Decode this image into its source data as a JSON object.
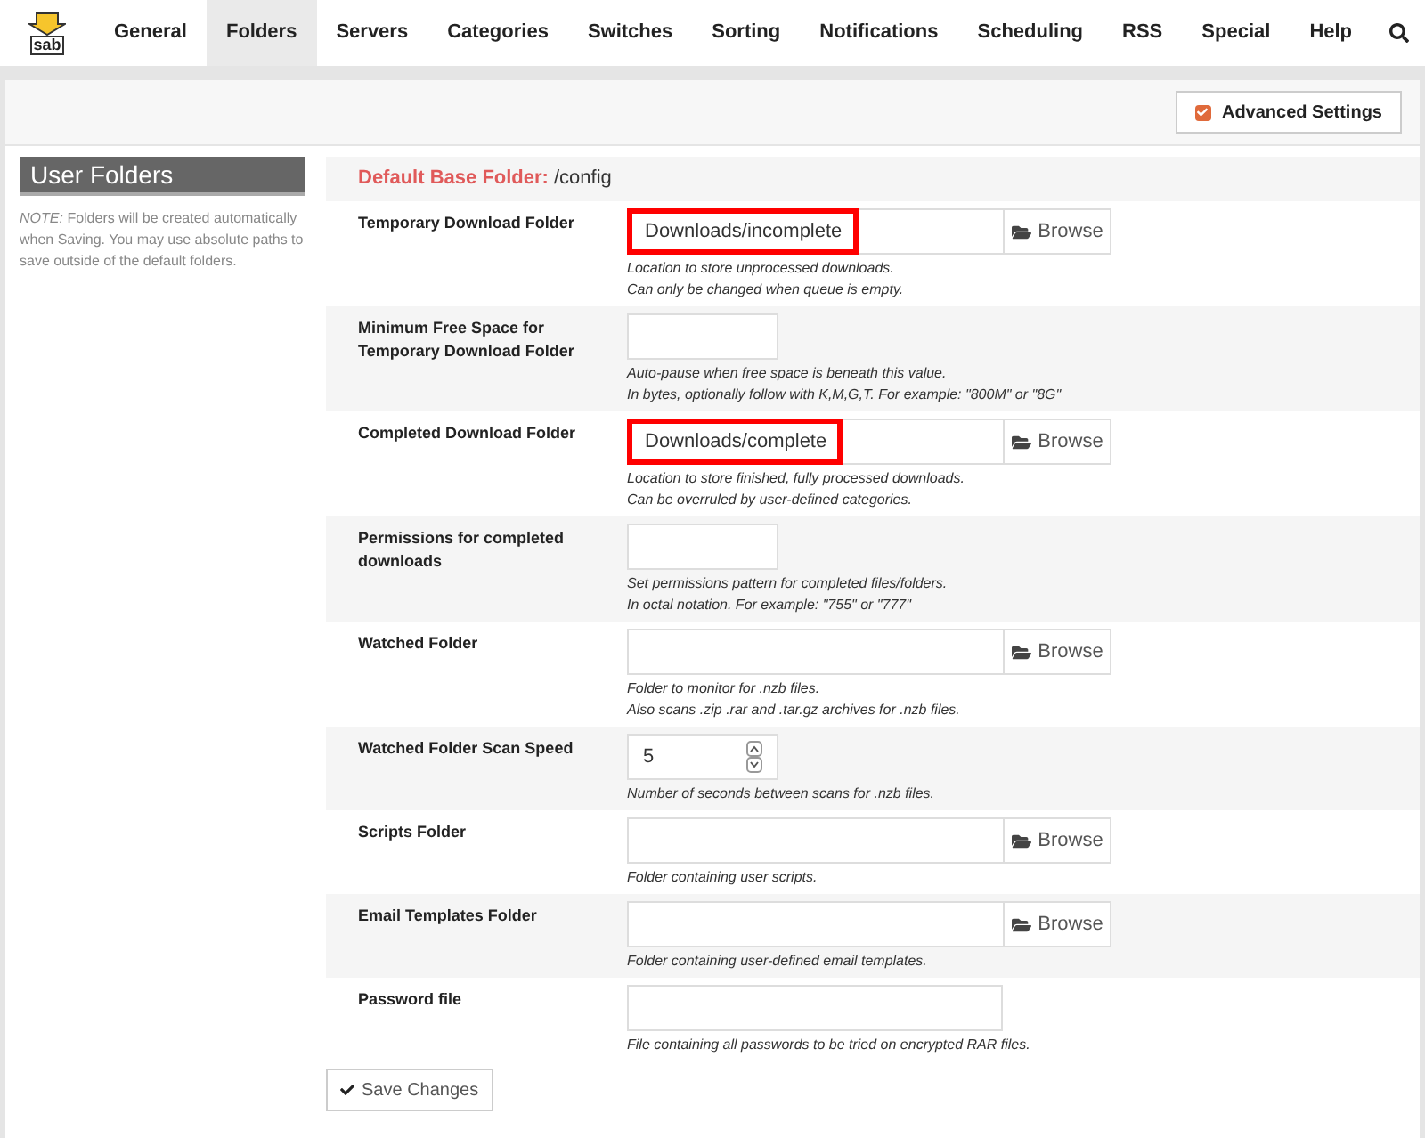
{
  "logo": {
    "text": "sab"
  },
  "nav": [
    {
      "label": "General",
      "selected": false
    },
    {
      "label": "Folders",
      "selected": true
    },
    {
      "label": "Servers",
      "selected": false
    },
    {
      "label": "Categories",
      "selected": false
    },
    {
      "label": "Switches",
      "selected": false
    },
    {
      "label": "Sorting",
      "selected": false
    },
    {
      "label": "Notifications",
      "selected": false
    },
    {
      "label": "Scheduling",
      "selected": false
    },
    {
      "label": "RSS",
      "selected": false
    },
    {
      "label": "Special",
      "selected": false
    },
    {
      "label": "Help",
      "selected": false
    }
  ],
  "advanced_settings": {
    "label": "Advanced Settings",
    "checked": true
  },
  "section": {
    "title": "User Folders",
    "note_label": "NOTE:",
    "note": "Folders will be created automatically when Saving. You may use absolute paths to save outside of the default folders."
  },
  "base_folder": {
    "label": "Default Base Folder:",
    "value": "/config"
  },
  "rows": [
    {
      "kind": "folder",
      "label": "Temporary Download Folder",
      "value": "Downloads/incomplete",
      "highlighted": true,
      "button": "Browse",
      "help": [
        "Location to store unprocessed downloads.",
        "Can only be changed when queue is empty."
      ]
    },
    {
      "kind": "text",
      "label": "Minimum Free Space for Temporary Download Folder",
      "value": "",
      "highlighted": false,
      "help": [
        "Auto-pause when free space is beneath this value.",
        "In bytes, optionally follow with K,M,G,T. For example: \"800M\" or \"8G\""
      ]
    },
    {
      "kind": "folder",
      "label": "Completed Download Folder",
      "value": "Downloads/complete",
      "highlighted": true,
      "button": "Browse",
      "help": [
        "Location to store finished, fully processed downloads.",
        "Can be overruled by user-defined categories."
      ]
    },
    {
      "kind": "text",
      "label": "Permissions for completed downloads",
      "value": "",
      "highlighted": false,
      "help": [
        "Set permissions pattern for completed files/folders.",
        "In octal notation. For example: \"755\" or \"777\""
      ]
    },
    {
      "kind": "folder",
      "label": "Watched Folder",
      "value": "",
      "highlighted": false,
      "button": "Browse",
      "help": [
        "Folder to monitor for .nzb files.",
        "Also scans .zip .rar and .tar.gz archives for .nzb files."
      ]
    },
    {
      "kind": "number",
      "label": "Watched Folder Scan Speed",
      "value": "5",
      "highlighted": false,
      "help": [
        "Number of seconds between scans for .nzb files."
      ]
    },
    {
      "kind": "folder",
      "label": "Scripts Folder",
      "value": "",
      "highlighted": false,
      "button": "Browse",
      "help": [
        "Folder containing user scripts."
      ]
    },
    {
      "kind": "folder",
      "label": "Email Templates Folder",
      "value": "",
      "highlighted": false,
      "button": "Browse",
      "help": [
        "Folder containing user-defined email templates."
      ]
    },
    {
      "kind": "file",
      "label": "Password file",
      "value": "",
      "highlighted": false,
      "help": [
        "File containing all passwords to be tried on encrypted RAR files."
      ]
    }
  ],
  "save_button": "Save Changes"
}
